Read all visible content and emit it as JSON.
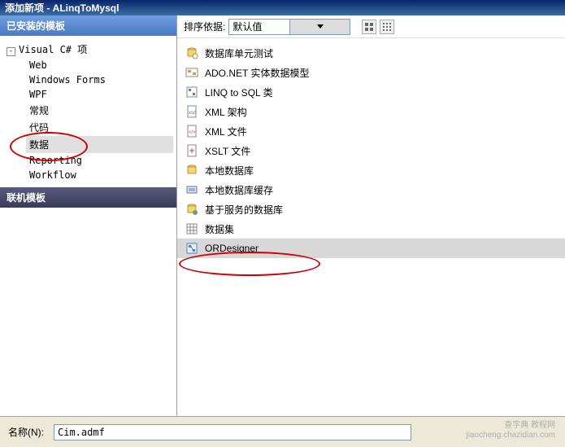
{
  "title": "添加新项 - ALinqToMysql",
  "sidebar": {
    "header_installed": "已安装的模板",
    "header_online": "联机模板",
    "root": "Visual C# 项",
    "items": [
      "Web",
      "Windows Forms",
      "WPF",
      "常规",
      "代码",
      "数据",
      "Reporting",
      "Workflow"
    ]
  },
  "toolbar": {
    "sort_label": "排序依据:",
    "sort_value": "默认值"
  },
  "templates": [
    "数据库单元测试",
    "ADO.NET 实体数据模型",
    "LINQ to SQL 类",
    "XML 架构",
    "XML 文件",
    "XSLT 文件",
    "本地数据库",
    "本地数据库缓存",
    "基于服务的数据库",
    "数据集",
    "ORDesigner"
  ],
  "template_icons": [
    "db-test",
    "model",
    "linq",
    "xsd",
    "xml",
    "xslt",
    "localdb",
    "cache",
    "servicedb",
    "dataset",
    "ord"
  ],
  "bottom": {
    "name_label": "名称(N):",
    "name_value": "Cim.admf"
  },
  "watermark": {
    "l1": "查字典  教程网",
    "l2": "jiaocheng.chazidian.com"
  }
}
